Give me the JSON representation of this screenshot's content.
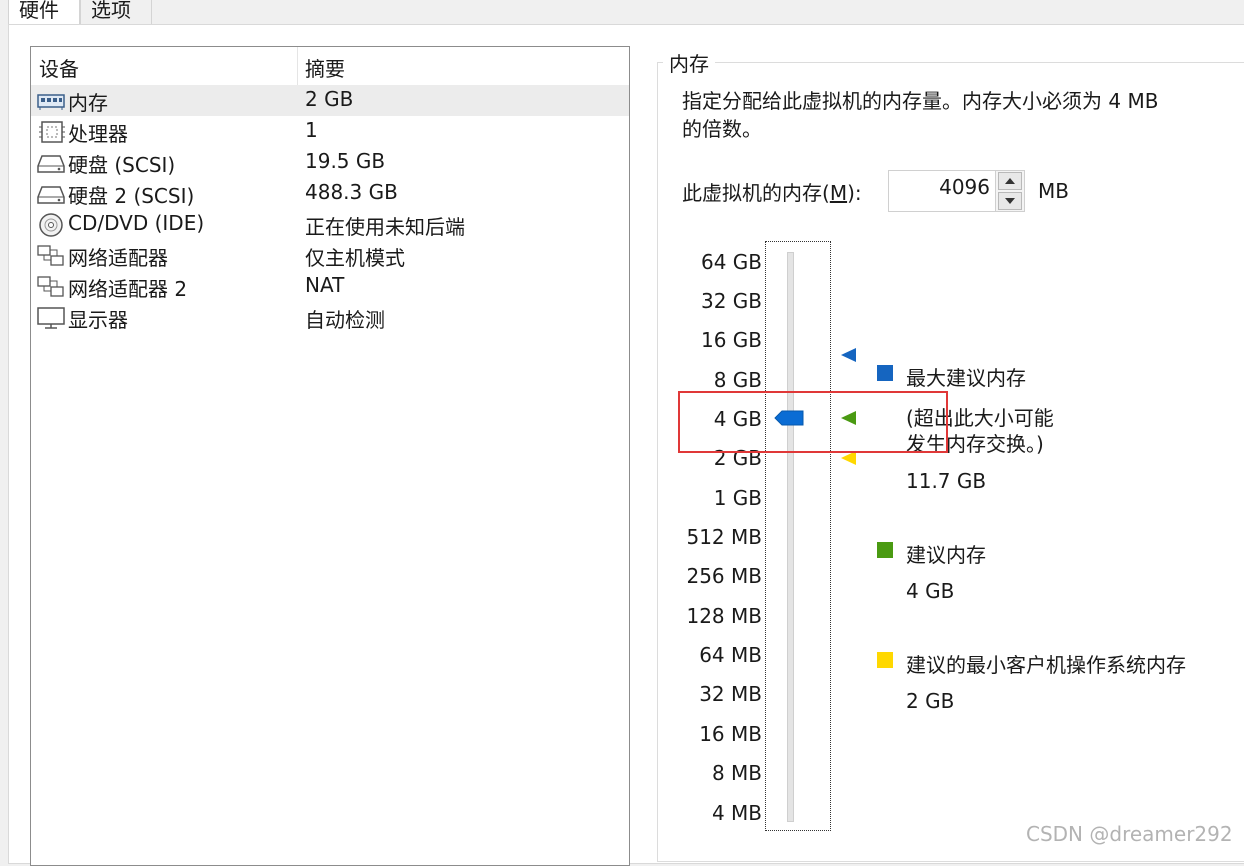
{
  "tabs": {
    "hardware": "硬件",
    "options": "选项"
  },
  "device_table": {
    "headers": {
      "device": "设备",
      "summary": "摘要"
    },
    "rows": [
      {
        "icon": "memory-icon",
        "name": "内存",
        "summary": "2 GB"
      },
      {
        "icon": "processor-icon",
        "name": "处理器",
        "summary": "1"
      },
      {
        "icon": "hard-disk-icon",
        "name": "硬盘 (SCSI)",
        "summary": "19.5 GB"
      },
      {
        "icon": "hard-disk-icon",
        "name": "硬盘 2 (SCSI)",
        "summary": "488.3 GB"
      },
      {
        "icon": "cd-dvd-icon",
        "name": "CD/DVD (IDE)",
        "summary": "正在使用未知后端"
      },
      {
        "icon": "network-adapter-icon",
        "name": "网络适配器",
        "summary": "仅主机模式"
      },
      {
        "icon": "network-adapter-icon",
        "name": "网络适配器 2",
        "summary": "NAT"
      },
      {
        "icon": "display-icon",
        "name": "显示器",
        "summary": "自动检测"
      }
    ]
  },
  "memory": {
    "group_title": "内存",
    "description_line1": "指定分配给此虚拟机的内存量。内存大小必须为 4 MB",
    "description_line2": "的倍数。",
    "label_prefix": "此虚拟机的内存(",
    "label_accel": "M",
    "label_suffix": "):",
    "value": "4096",
    "unit": "MB",
    "scale": [
      "64 GB",
      "32 GB",
      "16 GB",
      "8 GB",
      "4 GB",
      "2 GB",
      "1 GB",
      "512 MB",
      "256 MB",
      "128 MB",
      "64 MB",
      "32 MB",
      "16 MB",
      "8 MB",
      "4 MB"
    ],
    "slider_selected": "4 GB",
    "legend": {
      "max": {
        "title": "最大建议内存",
        "note_line1": "(超出此大小可能",
        "note_line2": "发生内存交换。)",
        "value": "11.7 GB",
        "color": "#1565c0"
      },
      "recommended": {
        "title": "建议内存",
        "value": "4 GB",
        "color": "#4a9a12"
      },
      "min_guest": {
        "title": "建议的最小客户机操作系统内存",
        "value": "2 GB",
        "color": "#ffd800"
      }
    }
  },
  "watermark": "CSDN @dreamer292"
}
